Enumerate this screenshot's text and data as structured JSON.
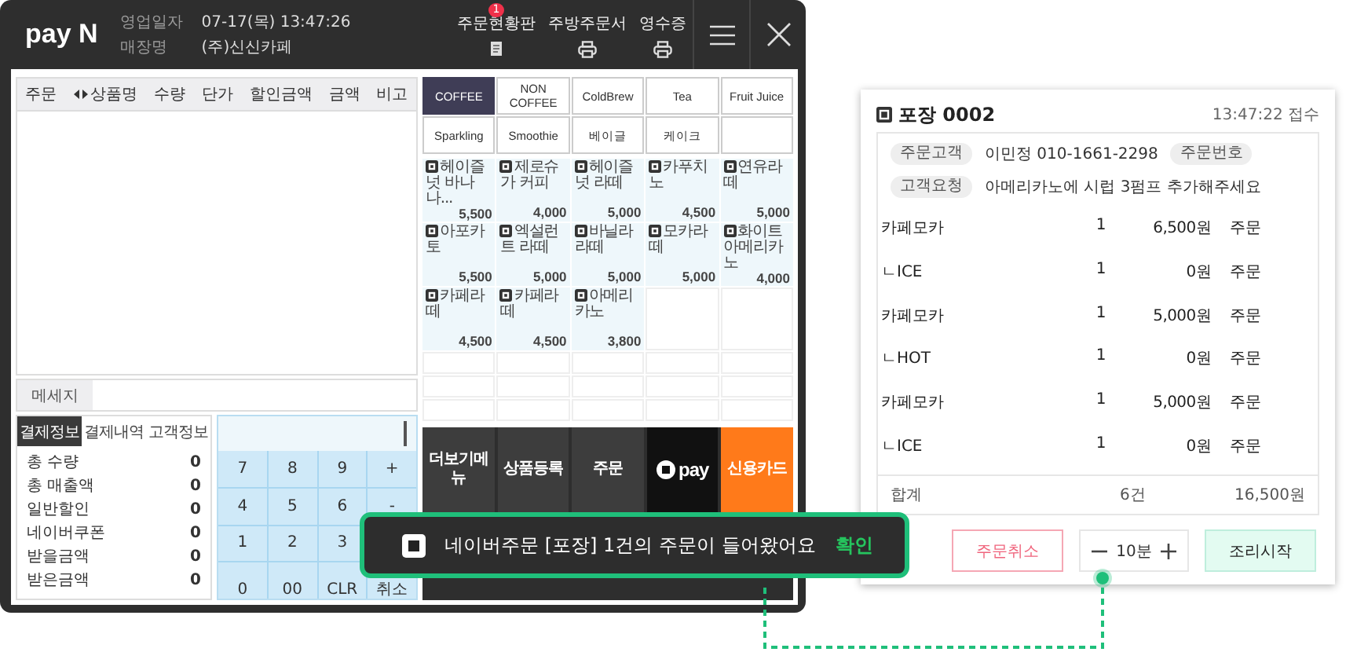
{
  "pos": {
    "logo": "pay N",
    "business_date_label": "영업일자",
    "business_date": "07-17(목) 13:47:26",
    "store_label": "매장명",
    "store": "(주)신신카페",
    "header_buttons": [
      {
        "label": "주문현황판",
        "kind": "board",
        "badge": "1"
      },
      {
        "label": "주방주문서",
        "kind": "printer"
      },
      {
        "label": "영수증",
        "kind": "printer"
      }
    ],
    "table": {
      "columns": [
        {
          "label": "주문",
          "sort_arrows": false
        },
        {
          "label": "상품명",
          "sort_arrows": true
        },
        {
          "label": "수량",
          "sort_arrows": false
        },
        {
          "label": "단가",
          "sort_arrows": false
        },
        {
          "label": "할인금액",
          "sort_arrows": false
        },
        {
          "label": "금액",
          "sort_arrows": false
        },
        {
          "label": "비고",
          "sort_arrows": false
        }
      ]
    },
    "message_label": "메세지",
    "info_tabs": [
      {
        "label": "결제정보",
        "selected": true
      },
      {
        "label": "결제내역",
        "selected": false
      },
      {
        "label": "고객정보",
        "selected": false
      }
    ],
    "summary": [
      {
        "label": "총 수량",
        "value": "0"
      },
      {
        "label": "총 매출액",
        "value": "0"
      },
      {
        "label": "일반할인",
        "value": "0"
      },
      {
        "label": "네이버쿠폰",
        "value": "0"
      },
      {
        "label": "받을금액",
        "value": "0"
      },
      {
        "label": "받은금액",
        "value": "0"
      }
    ],
    "keypad": {
      "rows": [
        [
          "7",
          "8",
          "9",
          "+"
        ],
        [
          "4",
          "5",
          "6",
          "-"
        ],
        [
          "1",
          "2",
          "3"
        ],
        [
          "0",
          "00",
          "CLR",
          "취소"
        ]
      ]
    },
    "categories": [
      {
        "label": "COFFEE",
        "selected": true
      },
      {
        "label": "NON COFFEE",
        "selected": false
      },
      {
        "label": "ColdBrew",
        "selected": false
      },
      {
        "label": "Tea",
        "selected": false
      },
      {
        "label": "Fruit Juice",
        "selected": false
      },
      {
        "label": "Sparkling",
        "selected": false
      },
      {
        "label": "Smoothie",
        "selected": false
      },
      {
        "label": "베이글",
        "selected": false
      },
      {
        "label": "케이크",
        "selected": false
      }
    ],
    "products": [
      {
        "name": "헤이즐넛 바나나...",
        "price": "5,500"
      },
      {
        "name": "제로슈가 커피",
        "price": "4,000"
      },
      {
        "name": "헤이즐넛 라떼",
        "price": "5,000"
      },
      {
        "name": "카푸치노",
        "price": "4,500"
      },
      {
        "name": "연유라떼",
        "price": "5,000"
      },
      {
        "name": "아포카토",
        "price": "5,500"
      },
      {
        "name": "엑설런트 라떼",
        "price": "5,000"
      },
      {
        "name": "바닐라라떼",
        "price": "5,000"
      },
      {
        "name": "모카라떼",
        "price": "5,000"
      },
      {
        "name": "화이트 아메리카노",
        "price": "4,000"
      },
      {
        "name": "카페라떼",
        "price": "4,500"
      },
      {
        "name": "카페라떼",
        "price": "4,500"
      },
      {
        "name": "아메리카노",
        "price": "3,800"
      }
    ],
    "actions": [
      {
        "label": "더보기메뉴",
        "kind": "dark"
      },
      {
        "label": "상품등록",
        "kind": "dark"
      },
      {
        "label": "주문",
        "kind": "dark"
      },
      {
        "label": "pay",
        "kind": "npay"
      },
      {
        "label": "신용카드",
        "kind": "card"
      }
    ]
  },
  "toast": {
    "message": "네이버주문 [포장] 1건의 주문이 들어왔어요",
    "button": "확인"
  },
  "order_card": {
    "title": "포장 0002",
    "received": "13:47:22 접수",
    "customer": {
      "label": "주문고객",
      "value": "이민정 010-1661-2298",
      "number_label": "주문번호"
    },
    "request": {
      "label": "고객요청",
      "value": "아메리카노에 시럽 3펌프 추가해주세요"
    },
    "items": [
      {
        "name": "카페모카",
        "qty": "1",
        "price": "6,500원",
        "status": "주문"
      },
      {
        "name": "ㄴICE",
        "qty": "1",
        "price": "0원",
        "status": "주문"
      },
      {
        "name": "카페모카",
        "qty": "1",
        "price": "5,000원",
        "status": "주문"
      },
      {
        "name": "ㄴHOT",
        "qty": "1",
        "price": "0원",
        "status": "주문"
      },
      {
        "name": "카페모카",
        "qty": "1",
        "price": "5,000원",
        "status": "주문"
      },
      {
        "name": "ㄴICE",
        "qty": "1",
        "price": "0원",
        "status": "주문"
      }
    ],
    "total": {
      "label": "합계",
      "count": "6건",
      "amount": "16,500원"
    },
    "cancel_button": "주문취소",
    "time_stepper": {
      "value": "10분"
    },
    "start_button": "조리시작"
  }
}
